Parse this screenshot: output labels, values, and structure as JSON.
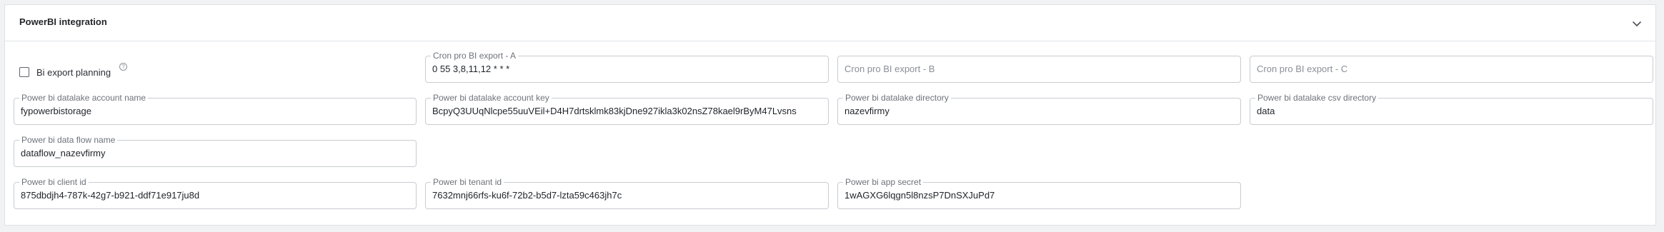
{
  "section": {
    "title": "PowerBI integration",
    "collapse_icon": "chevron-down-icon"
  },
  "checkbox": {
    "label": "Bi export planning",
    "checked": false,
    "help_icon": "question-circle-icon",
    "help_glyph": "?"
  },
  "fields": {
    "cron_a": {
      "label": "Cron pro BI export - A",
      "value": "0 55 3,8,11,12 * * *"
    },
    "cron_b": {
      "label": "",
      "placeholder": "Cron pro BI export - B"
    },
    "cron_c": {
      "label": "",
      "placeholder": "Cron pro BI export - C"
    },
    "account_name": {
      "label": "Power bi datalake account name",
      "value": "fypowerbistorage"
    },
    "account_key": {
      "label": "Power bi datalake account key",
      "value": "BcpyQ3UUqNlcpe55uuVEil+D4H7drtsklmk83kjDne927ikla3k02nsZ78kael9rByM47Lvsns"
    },
    "directory": {
      "label": "Power bi datalake directory",
      "value": "nazevfirmy"
    },
    "csv_directory": {
      "label": "Power bi datalake csv directory",
      "value": "data"
    },
    "flow_name": {
      "label": "Power bi data flow name",
      "value": "dataflow_nazevfirmy"
    },
    "client_id": {
      "label": "Power bi client id",
      "value": "875dbdjh4-787k-42g7-b921-ddf71e917ju8d"
    },
    "tenant_id": {
      "label": "Power bi tenant id",
      "value": "7632mnj66rfs-ku6f-72b2-b5d7-lzta59c463jh7c"
    },
    "app_secret": {
      "label": "Power bi app secret",
      "value": "1wAGXG6lqgn5l8nzsP7DnSXJuPd7"
    }
  }
}
